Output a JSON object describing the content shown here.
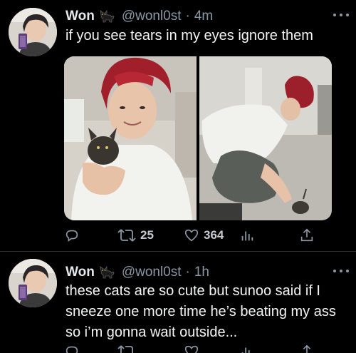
{
  "colors": {
    "background": "#000000",
    "text_primary": "#e7e9ea",
    "text_secondary": "#8b98a5",
    "divider": "#2f3336",
    "hair_red": "#a01f2a"
  },
  "tweets": [
    {
      "name": "Won",
      "name_emoji": "black-cat-icon",
      "handle": "@wonl0st",
      "separator": "·",
      "time": "4m",
      "text": "if you see tears in my eyes ignore them",
      "media": [
        {
          "description_icon": "photo-icon"
        },
        {
          "description_icon": "photo-icon"
        }
      ],
      "actions": {
        "reply_icon": "reply-icon",
        "retweet_icon": "retweet-icon",
        "retweet_count": "25",
        "like_icon": "heart-icon",
        "like_count": "364",
        "analytics_icon": "analytics-icon",
        "share_icon": "share-icon"
      }
    },
    {
      "name": "Won",
      "name_emoji": "black-cat-icon",
      "handle": "@wonl0st",
      "separator": "·",
      "time": "1h",
      "text": "these cats are so cute but sunoo said if I sneeze one more time he’s beating my ass so i’m gonna wait outside...",
      "actions": {
        "reply_icon": "reply-icon",
        "retweet_icon": "retweet-icon",
        "like_icon": "heart-icon",
        "analytics_icon": "analytics-icon",
        "share_icon": "share-icon"
      }
    }
  ]
}
